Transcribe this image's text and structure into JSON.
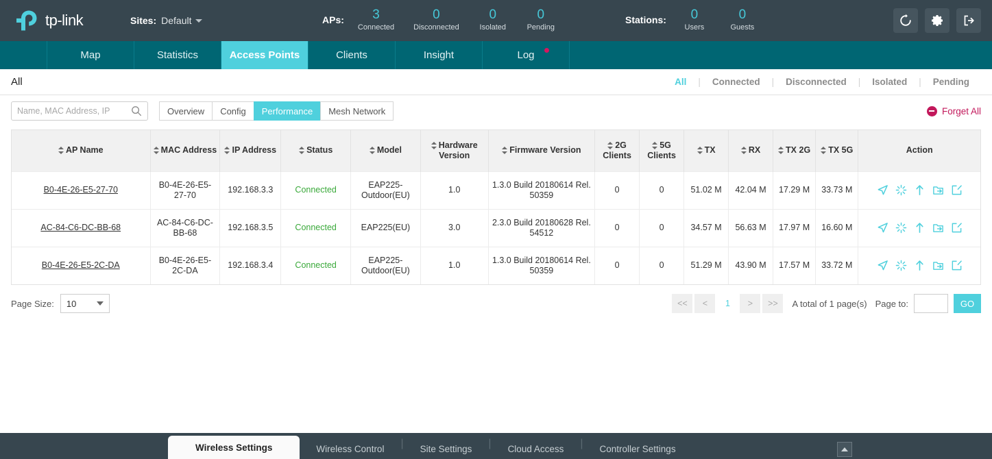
{
  "header": {
    "logo_text": "tp-link",
    "sites_label": "Sites:",
    "sites_value": "Default",
    "aps_label": "APs:",
    "stations_label": "Stations:",
    "ap_stats": [
      {
        "value": "3",
        "caption": "Connected"
      },
      {
        "value": "0",
        "caption": "Disconnected"
      },
      {
        "value": "0",
        "caption": "Isolated"
      },
      {
        "value": "0",
        "caption": "Pending"
      }
    ],
    "station_stats": [
      {
        "value": "0",
        "caption": "Users"
      },
      {
        "value": "0",
        "caption": "Guests"
      }
    ],
    "icons": [
      {
        "name": "refresh-icon"
      },
      {
        "name": "gear-icon"
      },
      {
        "name": "logout-icon"
      }
    ],
    "accent_color": "#4fd0dd",
    "bg_color": "#37464f"
  },
  "nav": {
    "tabs": [
      {
        "label": "Map",
        "active": false,
        "badge": false
      },
      {
        "label": "Statistics",
        "active": false,
        "badge": false
      },
      {
        "label": "Access Points",
        "active": true,
        "badge": false
      },
      {
        "label": "Clients",
        "active": false,
        "badge": false
      },
      {
        "label": "Insight",
        "active": false,
        "badge": false
      },
      {
        "label": "Log",
        "active": false,
        "badge": true
      }
    ],
    "bg_color": "#006673",
    "active_color": "#4fd0dd",
    "badge_color": "#d6175f"
  },
  "filterbar": {
    "title": "All",
    "links": [
      {
        "label": "All",
        "active": true
      },
      {
        "label": "Connected",
        "active": false
      },
      {
        "label": "Disconnected",
        "active": false
      },
      {
        "label": "Isolated",
        "active": false
      },
      {
        "label": "Pending",
        "active": false
      }
    ]
  },
  "toolbar": {
    "search_placeholder": "Name, MAC Address, IP",
    "search_value": "",
    "segments": [
      {
        "label": "Overview",
        "active": false
      },
      {
        "label": "Config",
        "active": false
      },
      {
        "label": "Performance",
        "active": true
      },
      {
        "label": "Mesh Network",
        "active": false
      }
    ],
    "forget_all_label": "Forget All",
    "forget_all_color": "#c2185b"
  },
  "table": {
    "columns": [
      {
        "label": "AP Name",
        "sortable": true
      },
      {
        "label": "MAC Address",
        "sortable": true
      },
      {
        "label": "IP Address",
        "sortable": true
      },
      {
        "label": "Status",
        "sortable": true
      },
      {
        "label": "Model",
        "sortable": true
      },
      {
        "label": "Hardware Version",
        "sortable": true
      },
      {
        "label": "Firmware Version",
        "sortable": true
      },
      {
        "label": "2G Clients",
        "sortable": true
      },
      {
        "label": "5G Clients",
        "sortable": true
      },
      {
        "label": "TX",
        "sortable": true
      },
      {
        "label": "RX",
        "sortable": true
      },
      {
        "label": "TX 2G",
        "sortable": true
      },
      {
        "label": "TX 5G",
        "sortable": true
      },
      {
        "label": "Action",
        "sortable": false
      }
    ],
    "rows": [
      {
        "ap_name": "B0-4E-26-E5-27-70",
        "mac": "B0-4E-26-E5-27-70",
        "ip": "192.168.3.3",
        "status": "Connected",
        "model": "EAP225-Outdoor(EU)",
        "hw_version": "1.0",
        "fw_version": "1.3.0 Build 20180614 Rel. 50359",
        "clients_2g": "0",
        "clients_5g": "0",
        "tx": "51.02 M",
        "rx": "42.04 M",
        "tx_2g": "17.29 M",
        "tx_5g": "33.73 M"
      },
      {
        "ap_name": "AC-84-C6-DC-BB-68",
        "mac": "AC-84-C6-DC-BB-68",
        "ip": "192.168.3.5",
        "status": "Connected",
        "model": "EAP225(EU)",
        "hw_version": "3.0",
        "fw_version": "2.3.0 Build 20180628 Rel. 54512",
        "clients_2g": "0",
        "clients_5g": "0",
        "tx": "34.57 M",
        "rx": "56.63 M",
        "tx_2g": "17.97 M",
        "tx_5g": "16.60 M"
      },
      {
        "ap_name": "B0-4E-26-E5-2C-DA",
        "mac": "B0-4E-26-E5-2C-DA",
        "ip": "192.168.3.4",
        "status": "Connected",
        "model": "EAP225-Outdoor(EU)",
        "hw_version": "1.0",
        "fw_version": "1.3.0 Build 20180614 Rel. 50359",
        "clients_2g": "0",
        "clients_5g": "0",
        "tx": "51.29 M",
        "rx": "43.90 M",
        "tx_2g": "17.57 M",
        "tx_5g": "33.72 M"
      }
    ],
    "action_icons": [
      {
        "name": "locate-icon"
      },
      {
        "name": "reboot-icon"
      },
      {
        "name": "upgrade-icon"
      },
      {
        "name": "move-icon"
      },
      {
        "name": "edit-icon"
      }
    ],
    "status_color": "#3aa93a",
    "action_icon_color": "#4fd0dd"
  },
  "pagination": {
    "page_size_label": "Page Size:",
    "page_size_value": "10",
    "first_label": "<<",
    "prev_label": "<",
    "current_page": "1",
    "next_label": ">",
    "last_label": ">>",
    "total_label": "A total of 1 page(s)",
    "page_to_label": "Page to:",
    "page_to_value": "",
    "go_label": "GO"
  },
  "bottombar": {
    "tabs": [
      {
        "label": "Wireless Settings",
        "active": true
      },
      {
        "label": "Wireless Control",
        "active": false
      },
      {
        "label": "Site Settings",
        "active": false
      },
      {
        "label": "Cloud Access",
        "active": false
      },
      {
        "label": "Controller Settings",
        "active": false
      }
    ]
  }
}
